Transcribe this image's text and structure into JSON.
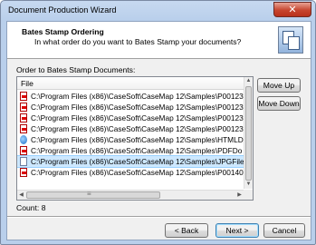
{
  "window": {
    "title": "Document Production Wizard",
    "close_glyph": "✕"
  },
  "header": {
    "title": "Bates Stamp Ordering",
    "subtitle": "In what order do you want to Bates Stamp your documents?",
    "icon": "documents-icon"
  },
  "list": {
    "label": "Order to Bates Stamp Documents:",
    "column_header": "File",
    "rows": [
      {
        "text": "C:\\Program Files (x86)\\CaseSoft\\CaseMap 12\\Samples\\P00123",
        "icon": "pdf-icon",
        "selected": false
      },
      {
        "text": "C:\\Program Files (x86)\\CaseSoft\\CaseMap 12\\Samples\\P00123",
        "icon": "pdf-icon",
        "selected": false
      },
      {
        "text": "C:\\Program Files (x86)\\CaseSoft\\CaseMap 12\\Samples\\P00123",
        "icon": "pdf-icon",
        "selected": false
      },
      {
        "text": "C:\\Program Files (x86)\\CaseSoft\\CaseMap 12\\Samples\\P00123",
        "icon": "pdf-icon",
        "selected": false
      },
      {
        "text": "C:\\Program Files (x86)\\CaseSoft\\CaseMap 12\\Samples\\HTMLD",
        "icon": "html-icon",
        "selected": false
      },
      {
        "text": "C:\\Program Files (x86)\\CaseSoft\\CaseMap 12\\Samples\\PDFDo",
        "icon": "pdf-icon",
        "selected": false
      },
      {
        "text": "C:\\Program Files (x86)\\CaseSoft\\CaseMap 12\\Samples\\JPGFile",
        "icon": "jpg-icon",
        "selected": true
      },
      {
        "text": "C:\\Program Files (x86)\\CaseSoft\\CaseMap 12\\Samples\\P00140",
        "icon": "pdf-icon",
        "selected": false
      }
    ],
    "count_label": "Count: 8"
  },
  "buttons": {
    "move_up": "Move Up",
    "move_down": "Move Down",
    "back": "< Back",
    "next": "Next >",
    "cancel": "Cancel"
  },
  "colors": {
    "selection": "#cde8ff",
    "close_button": "#c7452f",
    "title_bar": "#b9cfeb"
  }
}
